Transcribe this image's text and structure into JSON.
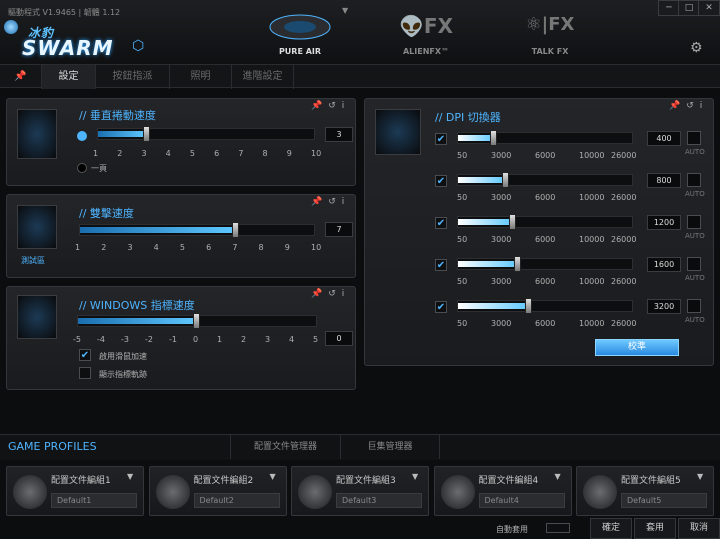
{
  "window": {
    "version": "驅動程式 V1.9465 | 韌體 1.12",
    "controls": [
      "─",
      "□",
      "✕"
    ]
  },
  "brand": {
    "top": "冰豹",
    "bottom": "SWARM"
  },
  "modes": [
    {
      "label": "PURE AIR"
    },
    {
      "label": "ALIENFX™"
    },
    {
      "label": "TALK FX"
    }
  ],
  "tabs": [
    "設定",
    "按鈕指派",
    "照明",
    "進階設定"
  ],
  "vertical": {
    "title": "// 垂直捲動速度",
    "value": "3",
    "level": 3,
    "min": 1,
    "max": 10,
    "ticks": [
      "1",
      "2",
      "3",
      "4",
      "5",
      "6",
      "7",
      "8",
      "9",
      "10"
    ],
    "page_option": "一頁"
  },
  "dblclick": {
    "title": "// 雙擊速度",
    "value": "7",
    "level": 7,
    "min": 1,
    "max": 10,
    "ticks": [
      "1",
      "2",
      "3",
      "4",
      "5",
      "6",
      "7",
      "8",
      "9",
      "10"
    ],
    "test_label": "測試區"
  },
  "pointer": {
    "title": "// WINDOWS 指標速度",
    "value": "0",
    "level": 0,
    "min": -5,
    "max": 5,
    "ticks": [
      "-5",
      "-4",
      "-3",
      "-2",
      "-1",
      "0",
      "1",
      "2",
      "3",
      "4",
      "5"
    ],
    "enhance": "啟用滑鼠加速",
    "trail": "顯示指標軌跡"
  },
  "dpi": {
    "title": "// DPI 切換器",
    "ticks": [
      "50",
      "3000",
      "6000",
      "10000",
      "26000"
    ],
    "auto": "AUTO",
    "calibrate": "校準",
    "max": 26000,
    "levels": [
      {
        "value": "400",
        "dpi": 400
      },
      {
        "value": "800",
        "dpi": 800
      },
      {
        "value": "1200",
        "dpi": 1200
      },
      {
        "value": "1600",
        "dpi": 1600
      },
      {
        "value": "3200",
        "dpi": 3200
      }
    ]
  },
  "profiles": {
    "header": "GAME PROFILES",
    "tab2": "配置文件管理器",
    "tab3": "巨集管理器",
    "items": [
      {
        "name": "配置文件編組1",
        "default": "Default1"
      },
      {
        "name": "配置文件編組2",
        "default": "Default2"
      },
      {
        "name": "配置文件編組3",
        "default": "Default3"
      },
      {
        "name": "配置文件編組4",
        "default": "Default4"
      },
      {
        "name": "配置文件編組5",
        "default": "Default5"
      }
    ]
  },
  "footer": {
    "auto_apply": "自動套用",
    "ok": "確定",
    "apply": "套用",
    "cancel": "取消"
  },
  "colors": {
    "accent": "#4fb4ff"
  }
}
